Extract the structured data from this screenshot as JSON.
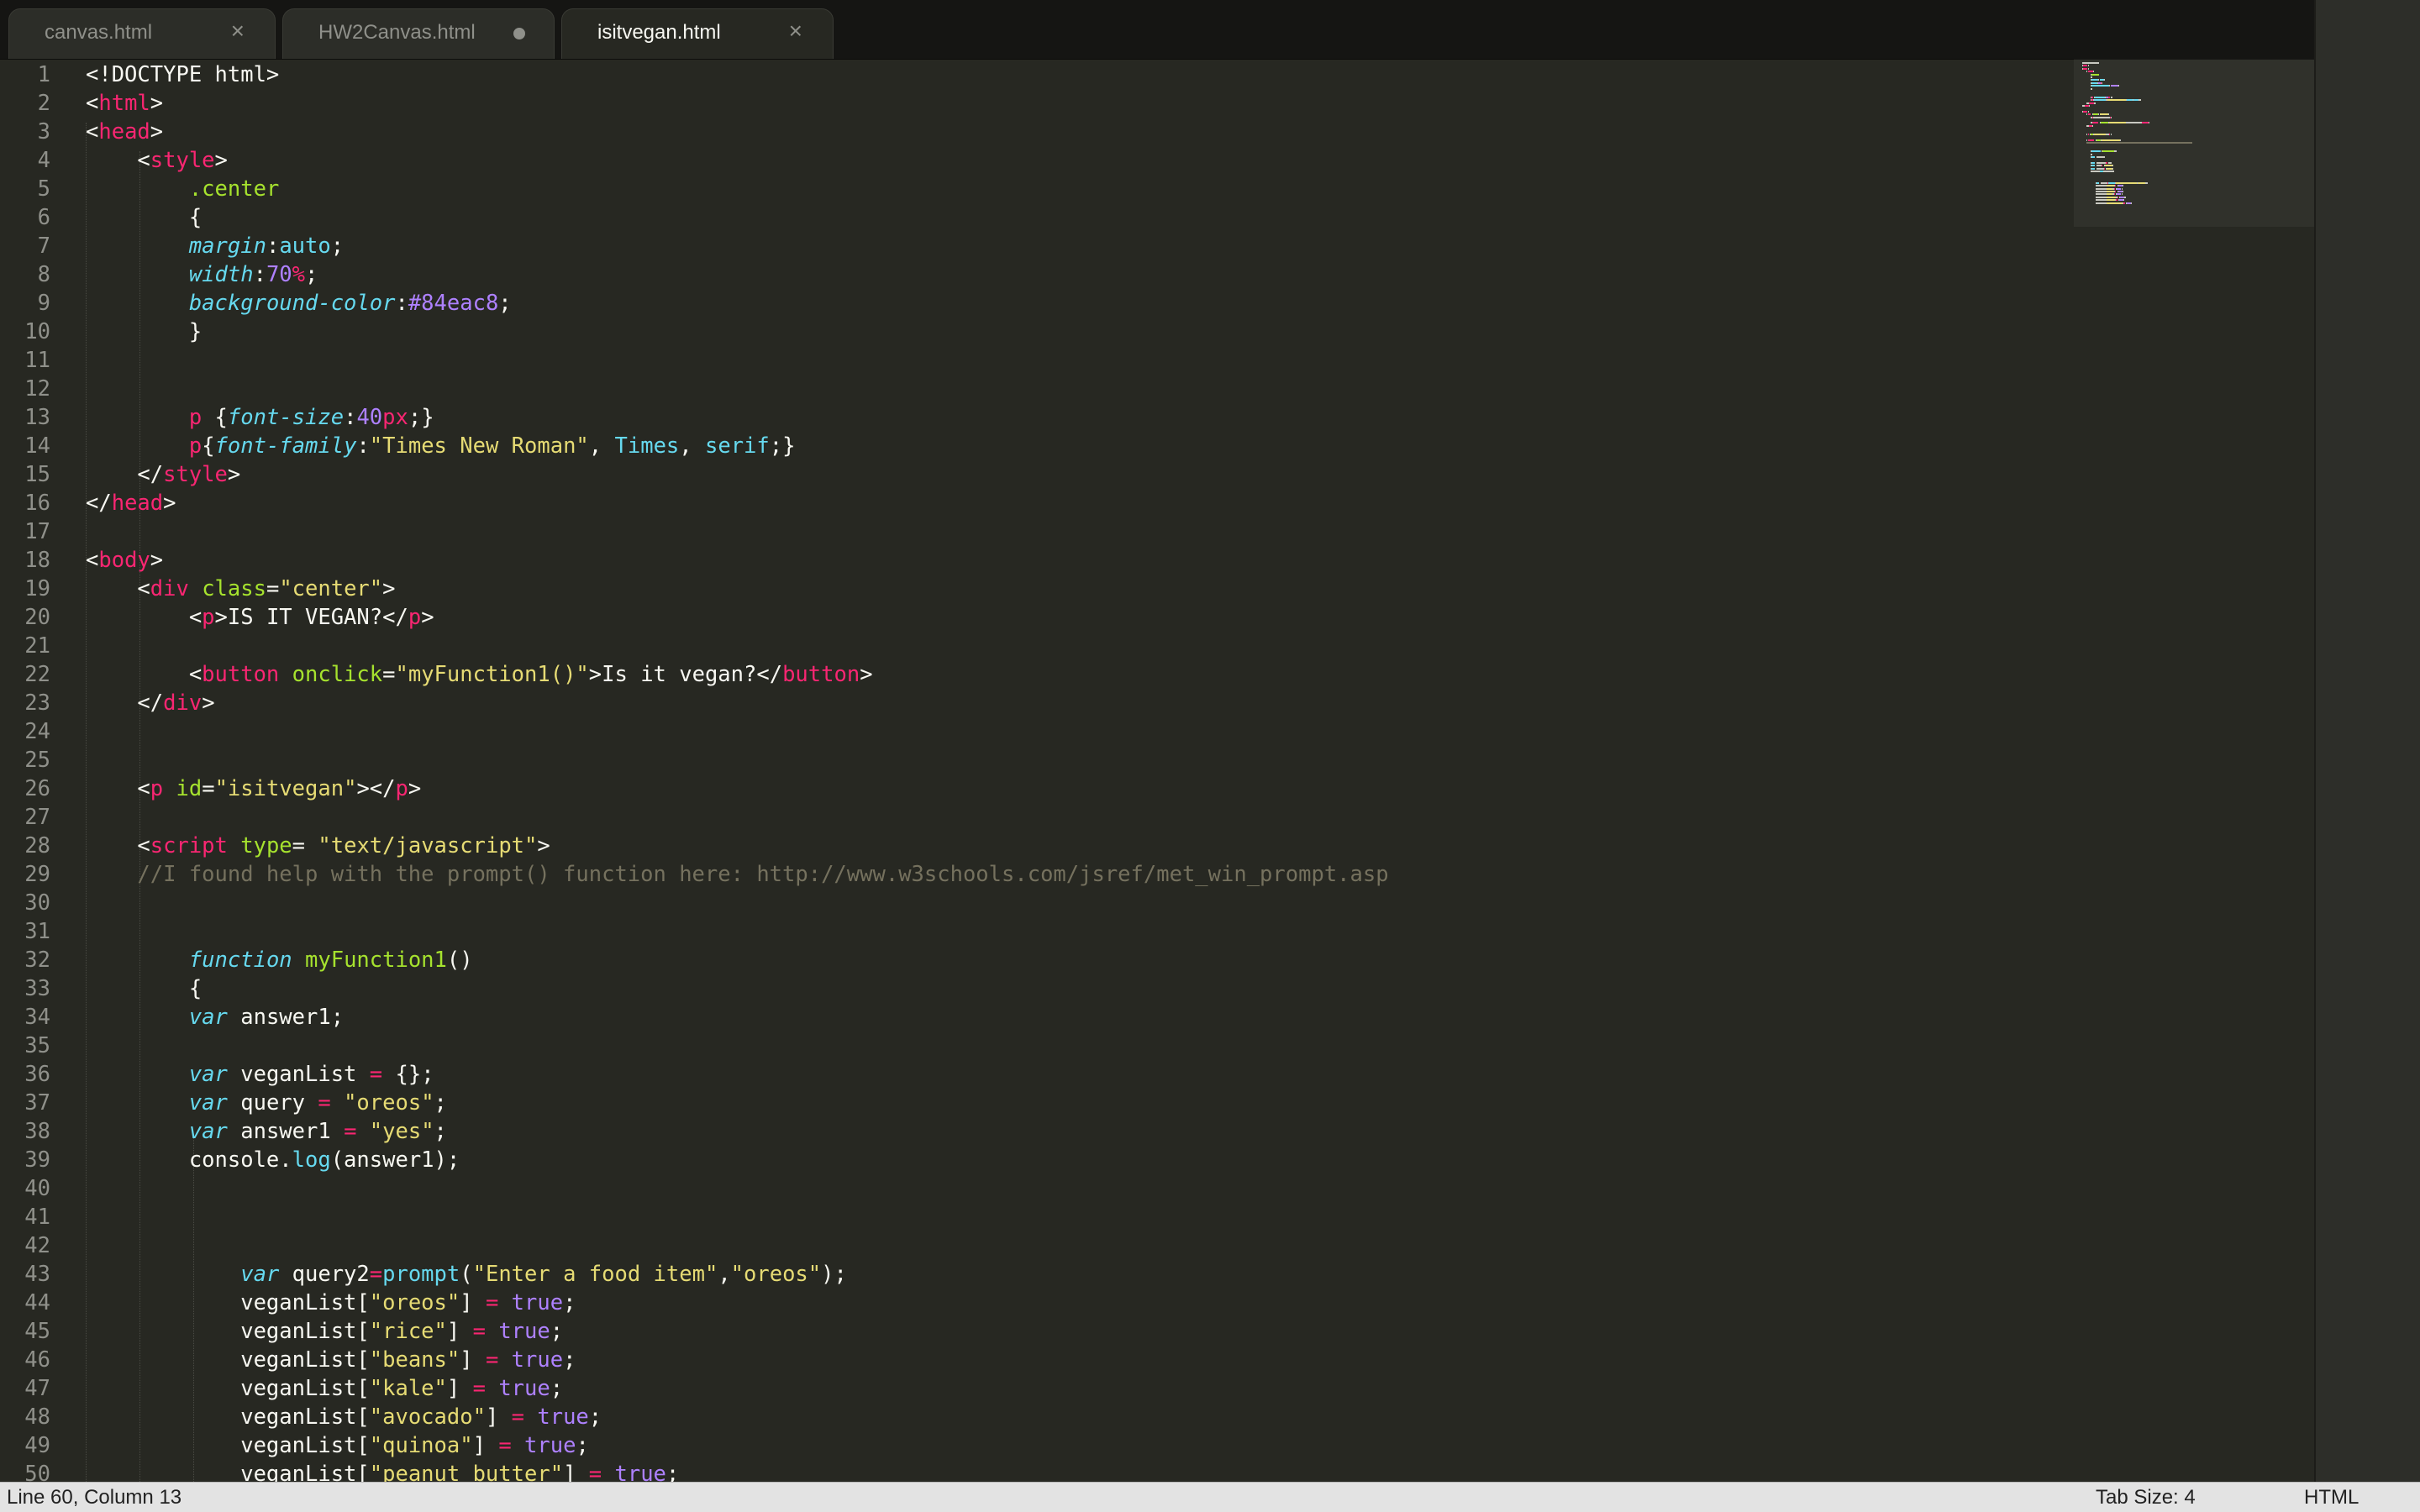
{
  "tabs": [
    {
      "label": "canvas.html",
      "state": "close"
    },
    {
      "label": "HW2Canvas.html",
      "state": "modified"
    },
    {
      "label": "isitvegan.html",
      "state": "close",
      "active": true
    }
  ],
  "icons": {
    "close": "×"
  },
  "lines": [
    {
      "n": "1",
      "code": [
        [
          "p",
          "<!DOCTYPE html>"
        ]
      ]
    },
    {
      "n": "2",
      "code": [
        [
          "p",
          "<"
        ],
        [
          "tg",
          "html"
        ],
        [
          "p",
          ">"
        ]
      ]
    },
    {
      "n": "3",
      "code": [
        [
          "p",
          "<"
        ],
        [
          "tg",
          "head"
        ],
        [
          "p",
          ">"
        ]
      ]
    },
    {
      "n": "4",
      "code": [
        [
          "p",
          "    <"
        ],
        [
          "tg",
          "style"
        ],
        [
          "p",
          ">"
        ]
      ]
    },
    {
      "n": "5",
      "code": [
        [
          "p",
          "        "
        ],
        [
          "at",
          ".center"
        ]
      ]
    },
    {
      "n": "6",
      "code": [
        [
          "p",
          "        {"
        ]
      ]
    },
    {
      "n": "7",
      "code": [
        [
          "p",
          "        "
        ],
        [
          "kw",
          "margin"
        ],
        [
          "p",
          ":"
        ],
        [
          "sp",
          "auto"
        ],
        [
          "p",
          ";"
        ]
      ]
    },
    {
      "n": "8",
      "code": [
        [
          "p",
          "        "
        ],
        [
          "kw",
          "width"
        ],
        [
          "p",
          ":"
        ],
        [
          "nm",
          "70"
        ],
        [
          "op",
          "%"
        ],
        [
          "p",
          ";"
        ]
      ]
    },
    {
      "n": "9",
      "code": [
        [
          "p",
          "        "
        ],
        [
          "kw",
          "background-color"
        ],
        [
          "p",
          ":"
        ],
        [
          "nm",
          "#84eac8"
        ],
        [
          "p",
          ";"
        ]
      ]
    },
    {
      "n": "10",
      "code": [
        [
          "p",
          "        }"
        ]
      ]
    },
    {
      "n": "11",
      "code": []
    },
    {
      "n": "12",
      "code": []
    },
    {
      "n": "13",
      "code": [
        [
          "p",
          "        "
        ],
        [
          "tg",
          "p"
        ],
        [
          "p",
          " {"
        ],
        [
          "kw",
          "font-size"
        ],
        [
          "p",
          ":"
        ],
        [
          "nm",
          "40"
        ],
        [
          "op",
          "px"
        ],
        [
          "p",
          ";}"
        ]
      ]
    },
    {
      "n": "14",
      "code": [
        [
          "p",
          "        "
        ],
        [
          "tg",
          "p"
        ],
        [
          "p",
          "{"
        ],
        [
          "kw",
          "font-family"
        ],
        [
          "p",
          ":"
        ],
        [
          "st",
          "\"Times New Roman\""
        ],
        [
          "p",
          ", "
        ],
        [
          "sp",
          "Times"
        ],
        [
          "p",
          ", "
        ],
        [
          "sp",
          "serif"
        ],
        [
          "p",
          ";}"
        ]
      ]
    },
    {
      "n": "15",
      "code": [
        [
          "p",
          "    </"
        ],
        [
          "tg",
          "style"
        ],
        [
          "p",
          ">"
        ]
      ]
    },
    {
      "n": "16",
      "code": [
        [
          "p",
          "</"
        ],
        [
          "tg",
          "head"
        ],
        [
          "p",
          ">"
        ]
      ]
    },
    {
      "n": "17",
      "code": []
    },
    {
      "n": "18",
      "code": [
        [
          "p",
          "<"
        ],
        [
          "tg",
          "body"
        ],
        [
          "p",
          ">"
        ]
      ]
    },
    {
      "n": "19",
      "code": [
        [
          "p",
          "    <"
        ],
        [
          "tg",
          "div"
        ],
        [
          "p",
          " "
        ],
        [
          "at",
          "class"
        ],
        [
          "p",
          "="
        ],
        [
          "st",
          "\"center\""
        ],
        [
          "p",
          ">"
        ]
      ]
    },
    {
      "n": "20",
      "code": [
        [
          "p",
          "        <"
        ],
        [
          "tg",
          "p"
        ],
        [
          "p",
          ">IS IT VEGAN?</"
        ],
        [
          "tg",
          "p"
        ],
        [
          "p",
          ">"
        ]
      ]
    },
    {
      "n": "21",
      "code": []
    },
    {
      "n": "22",
      "code": [
        [
          "p",
          "        <"
        ],
        [
          "tg",
          "button"
        ],
        [
          "p",
          " "
        ],
        [
          "at",
          "onclick"
        ],
        [
          "p",
          "="
        ],
        [
          "st",
          "\"myFunction1()\""
        ],
        [
          "p",
          ">Is it vegan?</"
        ],
        [
          "tg",
          "button"
        ],
        [
          "p",
          ">"
        ]
      ]
    },
    {
      "n": "23",
      "code": [
        [
          "p",
          "    </"
        ],
        [
          "tg",
          "div"
        ],
        [
          "p",
          ">"
        ]
      ]
    },
    {
      "n": "24",
      "code": []
    },
    {
      "n": "25",
      "code": []
    },
    {
      "n": "26",
      "code": [
        [
          "p",
          "    <"
        ],
        [
          "tg",
          "p"
        ],
        [
          "p",
          " "
        ],
        [
          "at",
          "id"
        ],
        [
          "p",
          "="
        ],
        [
          "st",
          "\"isitvegan\""
        ],
        [
          "p",
          "></"
        ],
        [
          "tg",
          "p"
        ],
        [
          "p",
          ">"
        ]
      ]
    },
    {
      "n": "27",
      "code": []
    },
    {
      "n": "28",
      "code": [
        [
          "p",
          "    <"
        ],
        [
          "tg",
          "script"
        ],
        [
          "p",
          " "
        ],
        [
          "at",
          "type"
        ],
        [
          "p",
          "= "
        ],
        [
          "st",
          "\"text/javascript\""
        ],
        [
          "p",
          ">"
        ]
      ]
    },
    {
      "n": "29",
      "code": [
        [
          "cm",
          "    //I found help with the prompt() function here: http://www.w3schools.com/jsref/met_win_prompt.asp"
        ]
      ]
    },
    {
      "n": "30",
      "code": []
    },
    {
      "n": "31",
      "code": []
    },
    {
      "n": "32",
      "code": [
        [
          "p",
          "        "
        ],
        [
          "kw",
          "function"
        ],
        [
          "p",
          " "
        ],
        [
          "fn",
          "myFunction1"
        ],
        [
          "p",
          "()"
        ]
      ]
    },
    {
      "n": "33",
      "code": [
        [
          "p",
          "        {"
        ]
      ]
    },
    {
      "n": "34",
      "code": [
        [
          "p",
          "        "
        ],
        [
          "kw",
          "var"
        ],
        [
          "p",
          " answer1;"
        ]
      ]
    },
    {
      "n": "35",
      "code": []
    },
    {
      "n": "36",
      "code": [
        [
          "p",
          "        "
        ],
        [
          "kw",
          "var"
        ],
        [
          "p",
          " veganList "
        ],
        [
          "op",
          "="
        ],
        [
          "p",
          " {};"
        ]
      ]
    },
    {
      "n": "37",
      "code": [
        [
          "p",
          "        "
        ],
        [
          "kw",
          "var"
        ],
        [
          "p",
          " query "
        ],
        [
          "op",
          "="
        ],
        [
          "p",
          " "
        ],
        [
          "st",
          "\"oreos\""
        ],
        [
          "p",
          ";"
        ]
      ]
    },
    {
      "n": "38",
      "code": [
        [
          "p",
          "        "
        ],
        [
          "kw",
          "var"
        ],
        [
          "p",
          " answer1 "
        ],
        [
          "op",
          "="
        ],
        [
          "p",
          " "
        ],
        [
          "st",
          "\"yes\""
        ],
        [
          "p",
          ";"
        ]
      ]
    },
    {
      "n": "39",
      "code": [
        [
          "p",
          "        console."
        ],
        [
          "sp",
          "log"
        ],
        [
          "p",
          "(answer1);"
        ]
      ]
    },
    {
      "n": "40",
      "code": []
    },
    {
      "n": "41",
      "code": []
    },
    {
      "n": "42",
      "code": []
    },
    {
      "n": "43",
      "code": [
        [
          "p",
          "            "
        ],
        [
          "kw",
          "var"
        ],
        [
          "p",
          " query2"
        ],
        [
          "op",
          "="
        ],
        [
          "sp",
          "prompt"
        ],
        [
          "p",
          "("
        ],
        [
          "st",
          "\"Enter a food item\""
        ],
        [
          "p",
          ","
        ],
        [
          "st",
          "\"oreos\""
        ],
        [
          "p",
          ");"
        ]
      ]
    },
    {
      "n": "44",
      "code": [
        [
          "p",
          "            veganList["
        ],
        [
          "st",
          "\"oreos\""
        ],
        [
          "p",
          "] "
        ],
        [
          "op",
          "="
        ],
        [
          "p",
          " "
        ],
        [
          "nm",
          "true"
        ],
        [
          "p",
          ";"
        ]
      ]
    },
    {
      "n": "45",
      "code": [
        [
          "p",
          "            veganList["
        ],
        [
          "st",
          "\"rice\""
        ],
        [
          "p",
          "] "
        ],
        [
          "op",
          "="
        ],
        [
          "p",
          " "
        ],
        [
          "nm",
          "true"
        ],
        [
          "p",
          ";"
        ]
      ]
    },
    {
      "n": "46",
      "code": [
        [
          "p",
          "            veganList["
        ],
        [
          "st",
          "\"beans\""
        ],
        [
          "p",
          "] "
        ],
        [
          "op",
          "="
        ],
        [
          "p",
          " "
        ],
        [
          "nm",
          "true"
        ],
        [
          "p",
          ";"
        ]
      ]
    },
    {
      "n": "47",
      "code": [
        [
          "p",
          "            veganList["
        ],
        [
          "st",
          "\"kale\""
        ],
        [
          "p",
          "] "
        ],
        [
          "op",
          "="
        ],
        [
          "p",
          " "
        ],
        [
          "nm",
          "true"
        ],
        [
          "p",
          ";"
        ]
      ]
    },
    {
      "n": "48",
      "code": [
        [
          "p",
          "            veganList["
        ],
        [
          "st",
          "\"avocado\""
        ],
        [
          "p",
          "] "
        ],
        [
          "op",
          "="
        ],
        [
          "p",
          " "
        ],
        [
          "nm",
          "true"
        ],
        [
          "p",
          ";"
        ]
      ]
    },
    {
      "n": "49",
      "code": [
        [
          "p",
          "            veganList["
        ],
        [
          "st",
          "\"quinoa\""
        ],
        [
          "p",
          "] "
        ],
        [
          "op",
          "="
        ],
        [
          "p",
          " "
        ],
        [
          "nm",
          "true"
        ],
        [
          "p",
          ";"
        ]
      ]
    },
    {
      "n": "50",
      "code": [
        [
          "p",
          "            veganList["
        ],
        [
          "st",
          "\"peanut butter\""
        ],
        [
          "p",
          "] "
        ],
        [
          "op",
          "="
        ],
        [
          "p",
          " "
        ],
        [
          "nm",
          "true"
        ],
        [
          "p",
          ";"
        ]
      ]
    }
  ],
  "status": {
    "position": "Line 60, Column 13",
    "tab_size": "Tab Size: 4",
    "syntax": "HTML"
  },
  "colors": {
    "background": "#272822",
    "tag": "#f92672",
    "attribute": "#a6e22e",
    "string": "#e6db74",
    "keyword": "#66d9ef",
    "number": "#ae81ff",
    "comment": "#75715e"
  }
}
